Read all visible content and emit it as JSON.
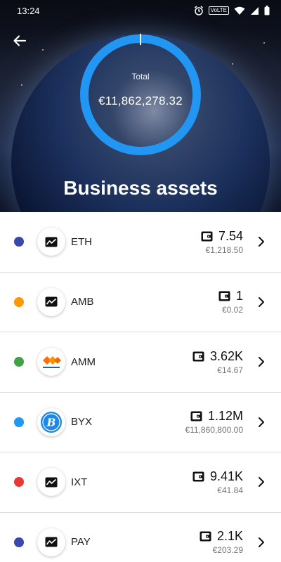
{
  "status_bar": {
    "time": "13:24",
    "network_badge": "VoLTE"
  },
  "header": {
    "back_icon": "arrow-left-icon",
    "total_label": "Total",
    "total_value": "€11,862,278.32",
    "title": "Business assets",
    "ring_color": "#2196f3"
  },
  "assets": [
    {
      "symbol": "ETH",
      "amount": "7.54",
      "fiat": "€1,218.50",
      "dot_color": "#3949ab",
      "logo": "generic-chart-icon"
    },
    {
      "symbol": "AMB",
      "amount": "1",
      "fiat": "€0.02",
      "dot_color": "#ff9800",
      "logo": "generic-chart-icon"
    },
    {
      "symbol": "AMM",
      "amount": "3.62K",
      "fiat": "€14.67",
      "dot_color": "#43a047",
      "logo": "micromoney-logo-icon"
    },
    {
      "symbol": "BYX",
      "amount": "1.12M",
      "fiat": "€11,860,800.00",
      "dot_color": "#2196f3",
      "logo": "bitcoinx-logo-icon"
    },
    {
      "symbol": "IXT",
      "amount": "9.41K",
      "fiat": "€41.84",
      "dot_color": "#e53935",
      "logo": "generic-chart-icon"
    },
    {
      "symbol": "PAY",
      "amount": "2.1K",
      "fiat": "€203.29",
      "dot_color": "#3949ab",
      "logo": "generic-chart-icon"
    }
  ]
}
